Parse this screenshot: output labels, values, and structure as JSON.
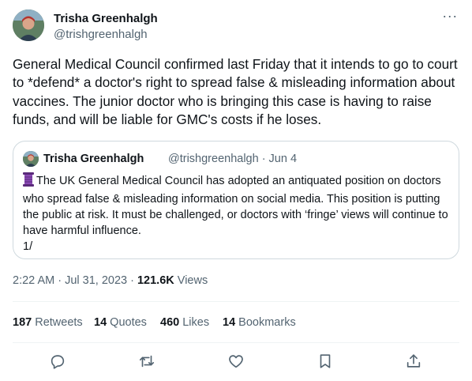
{
  "author": {
    "name": "Trisha Greenhalgh",
    "handle": "@trishgreenhalgh",
    "avatar_icon": "avatar-photo"
  },
  "more_label": "···",
  "tweet_text": "General Medical Council confirmed last Friday that it intends to go to court to *defend* a doctor's right to spread false & misleading information about vaccines. The junior doctor who is bringing this case is having to raise funds, and will be liable for GMC's costs if he loses.",
  "quote": {
    "name": "Trisha Greenhalgh",
    "meta": "@trishgreenhalgh · Jun 4",
    "icon": "spool-of-thread-icon",
    "text": "The UK General Medical Council has adopted an antiquated position on doctors who spread false & misleading information on social media. This position is putting the public at risk. It must be challenged, or doctors with ‘fringe’ views will continue to have harmful influence.",
    "thread_counter": "1/"
  },
  "meta": {
    "timestamp": "2:22 AM · Jul 31, 2023 · ",
    "views_count": "121.6K",
    "views_label": " Views"
  },
  "stats": [
    {
      "count": "187",
      "label": "Retweets"
    },
    {
      "count": "14",
      "label": "Quotes"
    },
    {
      "count": "460",
      "label": "Likes"
    },
    {
      "count": "14",
      "label": "Bookmarks"
    }
  ],
  "actions": [
    "reply-icon",
    "retweet-icon",
    "like-icon",
    "bookmark-icon",
    "share-icon"
  ],
  "colors": {
    "text": "#0f1419",
    "secondary": "#536471",
    "border": "#cfd9de",
    "thread_icon": "#7b3fa0"
  }
}
